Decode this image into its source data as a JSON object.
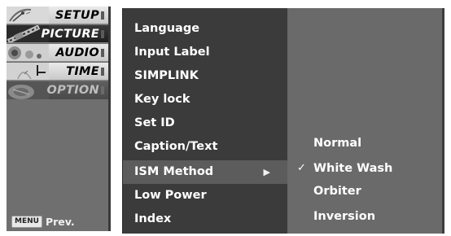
{
  "tabs": [
    {
      "label": "SETUP",
      "icon": "satellite-dish-icon",
      "style": "light"
    },
    {
      "label": "PICTURE",
      "icon": "picture-filmstrip-icon",
      "style": "dark"
    },
    {
      "label": "AUDIO",
      "icon": "speaker-icon",
      "style": "light"
    },
    {
      "label": "TIME",
      "icon": "clock-hands-icon",
      "style": "light"
    },
    {
      "label": "OPTION",
      "icon": "option-disc-icon",
      "style": "option"
    }
  ],
  "footer": {
    "menu_key": "MENU",
    "prev_label": "Prev."
  },
  "submenu": {
    "items": [
      "Language",
      "Input Label",
      "SIMPLINK",
      "Key lock",
      "Set ID",
      "Caption/Text",
      "ISM Method",
      "Low Power",
      "Index"
    ],
    "selected_index": 6,
    "selected_arrow": "▶"
  },
  "options": {
    "items": [
      "Normal",
      "White Wash",
      "Orbiter",
      "Inversion"
    ],
    "checked_index": 1,
    "check_mark": "✓"
  },
  "colors": {
    "tab_column": "#6f6f6f",
    "submenu_bg": "#3b3b3b",
    "submenu_selected": "#5c5c5c",
    "options_bg": "#6a6a6a"
  }
}
